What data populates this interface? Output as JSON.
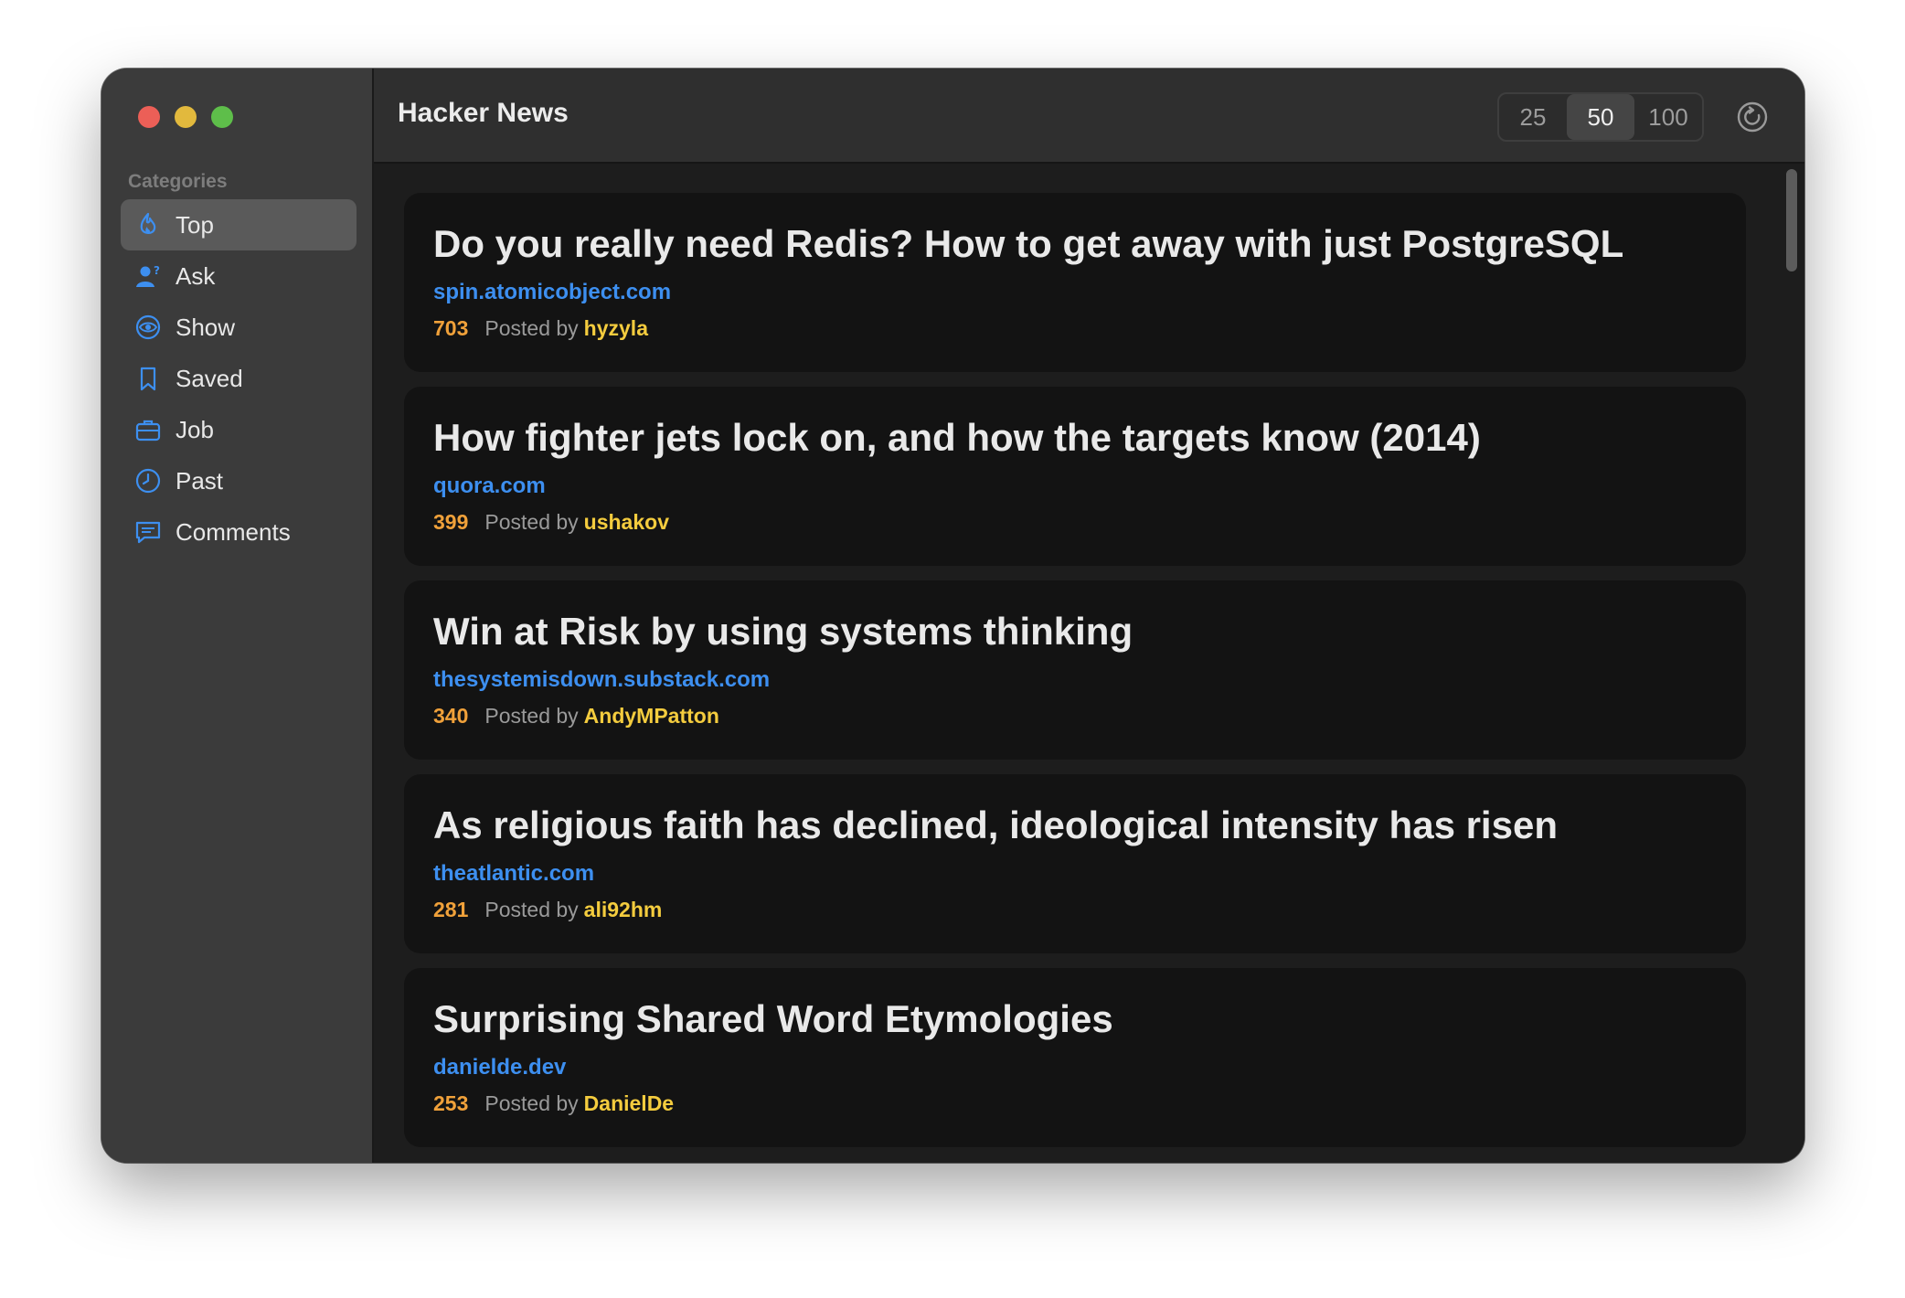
{
  "window": {
    "title": "Hacker News"
  },
  "sidebar": {
    "heading": "Categories",
    "items": [
      {
        "label": "Top",
        "icon": "flame-icon",
        "active": true
      },
      {
        "label": "Ask",
        "icon": "person-question-icon",
        "active": false
      },
      {
        "label": "Show",
        "icon": "eye-icon",
        "active": false
      },
      {
        "label": "Saved",
        "icon": "bookmark-icon",
        "active": false
      },
      {
        "label": "Job",
        "icon": "briefcase-icon",
        "active": false
      },
      {
        "label": "Past",
        "icon": "clock-icon",
        "active": false
      },
      {
        "label": "Comments",
        "icon": "message-icon",
        "active": false
      }
    ]
  },
  "toolbar": {
    "count_options": [
      "25",
      "50",
      "100"
    ],
    "selected_count": "50",
    "refresh_icon": "refresh-icon"
  },
  "stories": [
    {
      "title": "Do you really need Redis? How to get away with just PostgreSQL",
      "domain": "spin.atomicobject.com",
      "score": "703",
      "posted_by": "Posted by",
      "author": "hyzyla"
    },
    {
      "title": "How fighter jets lock on, and how the targets know (2014)",
      "domain": "quora.com",
      "score": "399",
      "posted_by": "Posted by",
      "author": "ushakov"
    },
    {
      "title": "Win at Risk by using systems thinking",
      "domain": "thesystemisdown.substack.com",
      "score": "340",
      "posted_by": "Posted by",
      "author": "AndyMPatton"
    },
    {
      "title": "As religious faith has declined, ideological intensity has risen",
      "domain": "theatlantic.com",
      "score": "281",
      "posted_by": "Posted by",
      "author": "ali92hm"
    },
    {
      "title": "Surprising Shared Word Etymologies",
      "domain": "danielde.dev",
      "score": "253",
      "posted_by": "Posted by",
      "author": "DanielDe"
    }
  ],
  "colors": {
    "accent": "#3d8ff0",
    "score": "#f0a13a",
    "author": "#f4cc3e"
  }
}
